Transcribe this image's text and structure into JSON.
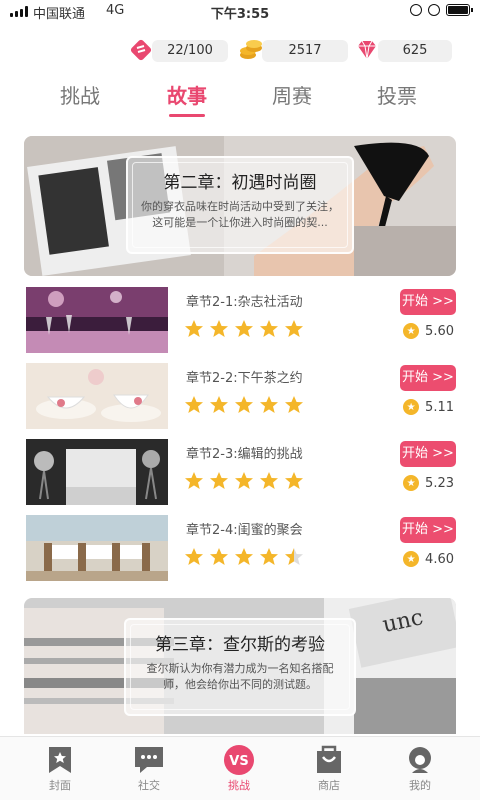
{
  "status": {
    "carrier": "中国联通",
    "network": "4G",
    "time": "下午3:55"
  },
  "resources": [
    {
      "icon": "energy-icon",
      "value": "22/100"
    },
    {
      "icon": "coin-icon",
      "value": "2517"
    },
    {
      "icon": "diamond-icon",
      "value": "625"
    }
  ],
  "tabs": [
    {
      "label": "挑战",
      "active": false
    },
    {
      "label": "故事",
      "active": true
    },
    {
      "label": "周赛",
      "active": false
    },
    {
      "label": "投票",
      "active": false
    }
  ],
  "chapters": [
    {
      "title": "第二章：初遇时尚圈",
      "desc": "你的穿衣品味在时尚活动中受到了关注，这可能是一个让你进入时尚圈的契..."
    },
    {
      "title": "第三章：查尔斯的考验",
      "desc": "查尔斯认为你有潜力成为一名知名搭配师，他会给你出不同的测试题。"
    }
  ],
  "sections": [
    {
      "name": "章节2-1:杂志社活动",
      "button": "开始 >>",
      "score": "5.60",
      "stars": 5
    },
    {
      "name": "章节2-2:下午茶之约",
      "button": "开始 >>",
      "score": "5.11",
      "stars": 5
    },
    {
      "name": "章节2-3:编辑的挑战",
      "button": "开始 >>",
      "score": "5.23",
      "stars": 5
    },
    {
      "name": "章节2-4:闺蜜的聚会",
      "button": "开始 >>",
      "score": "4.60",
      "stars": 4.5
    }
  ],
  "nav": [
    {
      "label": "封面",
      "icon": "bookmark-icon"
    },
    {
      "label": "社交",
      "icon": "chat-icon"
    },
    {
      "label": "挑战",
      "icon": "vs-icon",
      "active": true
    },
    {
      "label": "商店",
      "icon": "shop-bag-icon"
    },
    {
      "label": "我的",
      "icon": "profile-icon"
    }
  ],
  "colors": {
    "accent": "#e94870",
    "button": "#ec4d6f",
    "star": "#f4b62a"
  }
}
